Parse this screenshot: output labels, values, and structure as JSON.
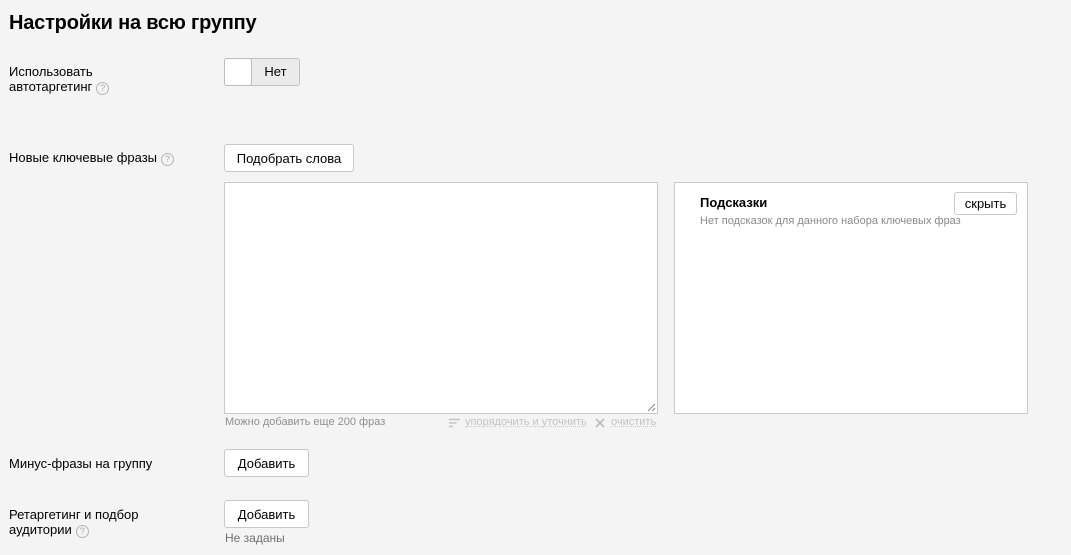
{
  "page": {
    "title": "Настройки на всю группу"
  },
  "autotargeting": {
    "label_line1": "Использовать",
    "label_line2": "автотаргетинг",
    "help": "?",
    "toggle_value": "Нет"
  },
  "keywords": {
    "label": "Новые ключевые фразы",
    "help": "?",
    "pick_button": "Подобрать слова",
    "textarea_value": "",
    "counter": "Можно добавить еще 200 фраз",
    "sort_link": "упорядочить и уточнить",
    "clear_link": "очистить",
    "icons": {
      "sort": "sort-lines-icon",
      "clear": "cross-icon",
      "resize": "resize-grip-icon"
    }
  },
  "hints": {
    "title": "Подсказки",
    "hide_button": "скрыть",
    "empty_text": "Нет подсказок для данного набора ключевых фраз"
  },
  "negative": {
    "label": "Минус-фразы на группу",
    "add_button": "Добавить"
  },
  "retargeting": {
    "label_line1": "Ретаргетинг и подбор",
    "label_line2": "аудитории",
    "help": "?",
    "add_button": "Добавить",
    "status": "Не заданы"
  }
}
